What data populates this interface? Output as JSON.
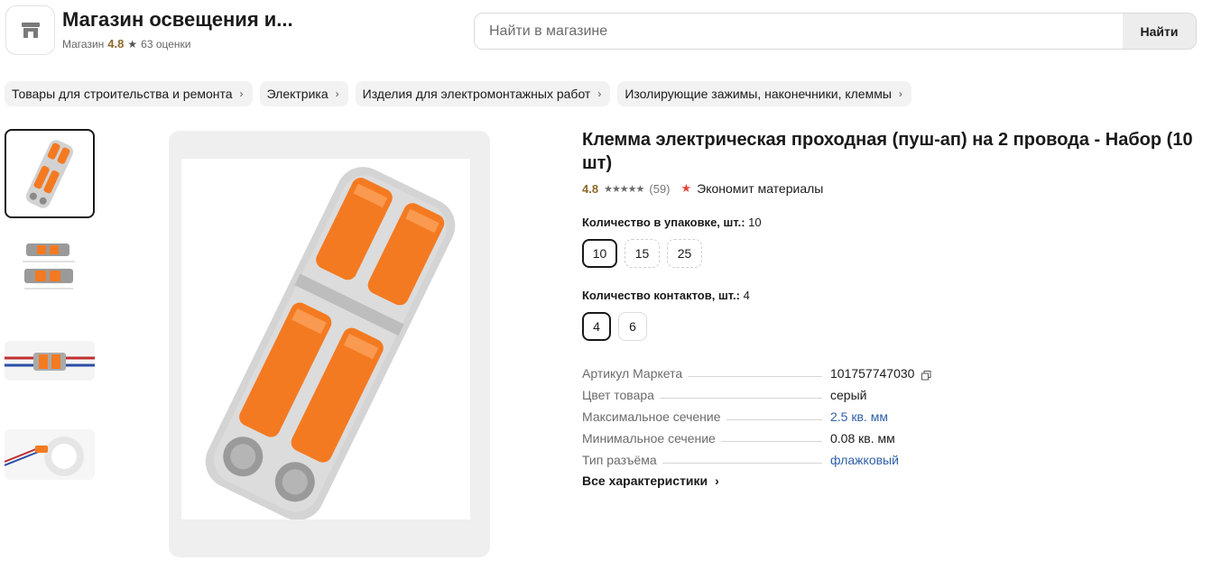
{
  "store": {
    "name": "Магазин освещения и...",
    "type_label": "Магазин",
    "rating": "4.8",
    "reviews": "63 оценки",
    "icon": "storefront-icon"
  },
  "search": {
    "placeholder": "Найти в магазине",
    "value": "",
    "button": "Найти"
  },
  "breadcrumbs": [
    {
      "label": "Товары для строительства и ремонта"
    },
    {
      "label": "Электрика"
    },
    {
      "label": "Изделия для электромонтажных работ"
    },
    {
      "label": "Изолирующие зажимы, наконечники, клеммы"
    }
  ],
  "gallery": {
    "thumbnails": [
      "connector-front",
      "connector-dimensions",
      "connector-wired",
      "connector-in-ring"
    ],
    "selected_index": 0
  },
  "product": {
    "title": "Клемма электрическая проходная (пуш-ап) на 2 провода - Набор (10 шт)",
    "rating": "4.8",
    "stars": "★★★★★",
    "review_count": "(59)",
    "badge": "Экономит материалы",
    "badge_icon": "star-badge-icon"
  },
  "options": {
    "pack_qty": {
      "label": "Количество в упаковке, шт.:",
      "value": "10",
      "choices": [
        "10",
        "15",
        "25"
      ],
      "selected": "10"
    },
    "contacts": {
      "label": "Количество контактов, шт.:",
      "value": "4",
      "choices": [
        "4",
        "6"
      ],
      "selected": "4"
    }
  },
  "specs": [
    {
      "key": "Артикул Маркета",
      "value": "101757747030",
      "link": false,
      "copy": true
    },
    {
      "key": "Цвет товара",
      "value": "серый",
      "link": false,
      "copy": false
    },
    {
      "key": "Максимальное сечение",
      "value": "2.5 кв. мм",
      "link": true,
      "copy": false
    },
    {
      "key": "Минимальное сечение",
      "value": "0.08 кв. мм",
      "link": false,
      "copy": false
    },
    {
      "key": "Тип разъёма",
      "value": "флажковый",
      "link": true,
      "copy": false
    }
  ],
  "all_specs_label": "Все характеристики",
  "colors": {
    "rating": "#8c6a2a",
    "link": "#2f5fa8",
    "badge": "#e8453c",
    "connector_gray": "#d2d2d2",
    "connector_orange": "#f47a21"
  }
}
